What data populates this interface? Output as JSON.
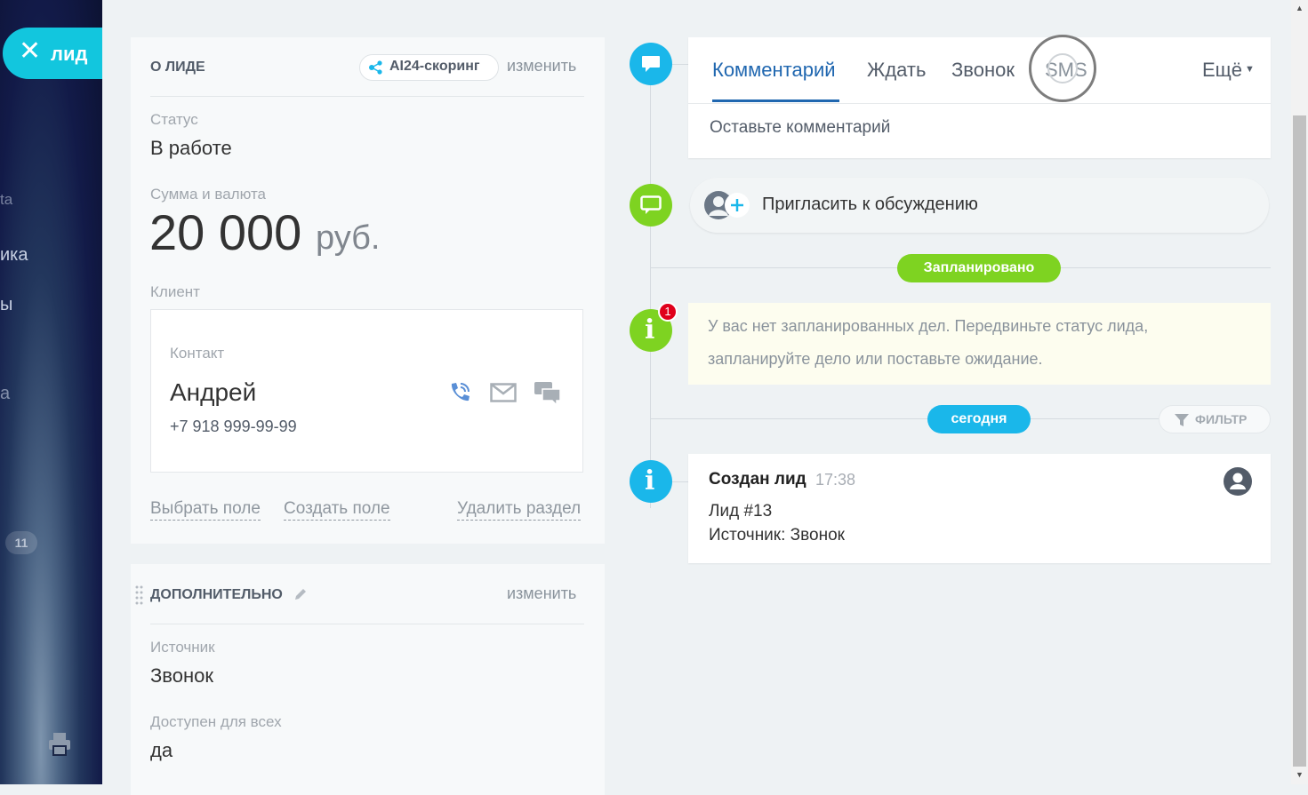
{
  "sidebar": {
    "close_label": "лид",
    "fragments": [
      "ta",
      "ика",
      "ы",
      "а"
    ],
    "badge_count": "11"
  },
  "about": {
    "title": "О ЛИДЕ",
    "ai_label": "AI24-скоринг",
    "edit_label": "изменить",
    "status_label": "Статус",
    "status_value": "В работе",
    "amount_label": "Сумма и валюта",
    "amount_value": "20 000",
    "currency": "руб.",
    "client_label": "Клиент",
    "contact_label": "Контакт",
    "contact_name": "Андрей",
    "contact_phone": "+7 918 999-99-99",
    "select_field": "Выбрать поле",
    "create_field": "Создать поле",
    "delete_section": "Удалить раздел"
  },
  "additional": {
    "title": "ДОПОЛНИТЕЛЬНО",
    "edit_label": "изменить",
    "source_label": "Источник",
    "source_value": "Звонок",
    "available_label": "Доступен для всех",
    "available_value": "да"
  },
  "timeline": {
    "tabs": [
      "Комментарий",
      "Ждать",
      "Звонок",
      "SMS"
    ],
    "more_label": "Ещё",
    "comment_placeholder": "Оставьте комментарий",
    "invite_label": "Пригласить к обсуждению",
    "planned_tag": "Запланировано",
    "notice_count": "1",
    "notice_line1": "У вас нет запланированных дел. Передвиньте статус лида,",
    "notice_line2": "запланируйте дело или поставьте ожидание.",
    "today_tag": "сегодня",
    "filter_label": "ФИЛЬТР",
    "event_title": "Создан лид",
    "event_time": "17:38",
    "event_line1": "Лид #13",
    "event_line2": "Источник: Звонок"
  },
  "colors": {
    "accent_blue": "#2067b0",
    "teal": "#12c6de",
    "green": "#7ed321",
    "sky": "#1ab7ea",
    "red": "#e0001b"
  }
}
